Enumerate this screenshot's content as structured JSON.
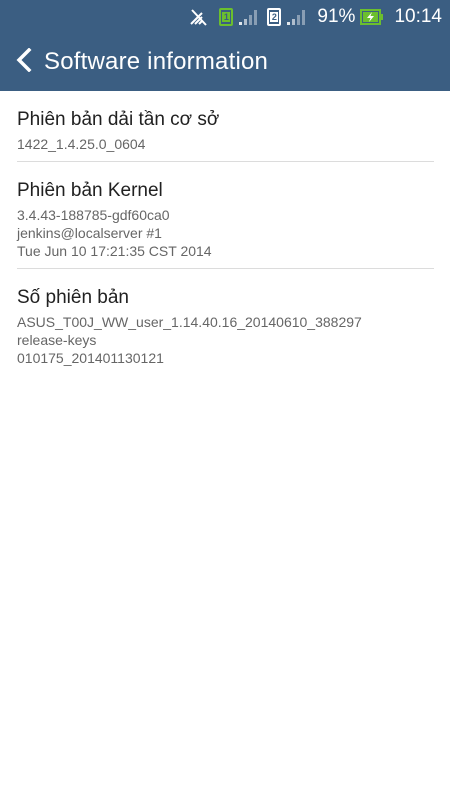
{
  "status_bar": {
    "sim1_label": "1",
    "sim2_label": "2",
    "battery_percent": "91%",
    "time": "10:14",
    "icons": [
      "mute-icon",
      "sim1-icon",
      "signal-icon",
      "sim2-icon",
      "signal-icon",
      "battery-charging-icon"
    ],
    "sim1_color": "#6bbf2e",
    "battery_color": "#6bbf2e"
  },
  "app_bar": {
    "title": "Software information",
    "back_icon": "chevron-left-icon",
    "background": "#3b5e82"
  },
  "items": [
    {
      "title": "Phiên bản dải tần cơ sở",
      "lines": [
        "1422_1.4.25.0_0604"
      ]
    },
    {
      "title": "Phiên bản Kernel",
      "lines": [
        "3.4.43-188785-gdf60ca0",
        "jenkins@localserver #1",
        "Tue Jun 10 17:21:35 CST 2014"
      ]
    },
    {
      "title": "Số phiên bản",
      "lines": [
        "ASUS_T00J_WW_user_1.14.40.16_20140610_388297",
        "release-keys",
        "010175_201401130121"
      ]
    }
  ]
}
